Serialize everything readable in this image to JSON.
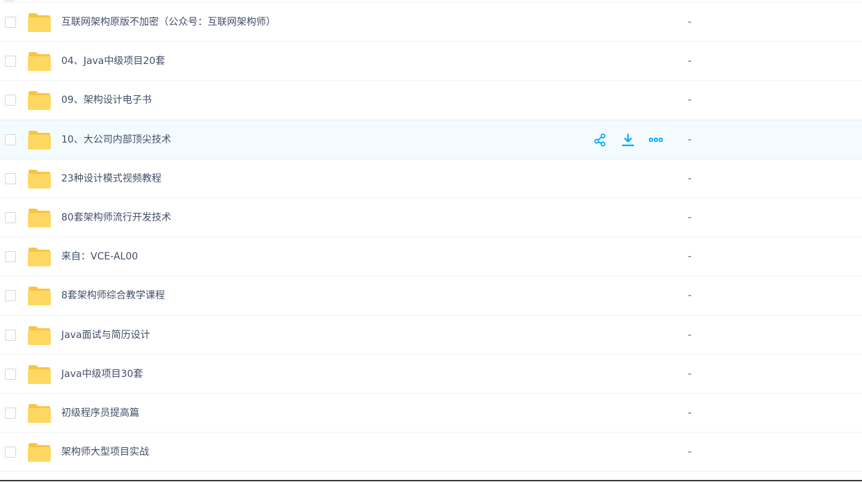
{
  "file_list": {
    "rows": [
      {
        "name": "互联网架构原版不加密（公众号：互联网架构师）",
        "size": "-"
      },
      {
        "name": "04、Java中级项目20套",
        "size": "-"
      },
      {
        "name": "09、架构设计电子书",
        "size": "-"
      },
      {
        "name": "10、大公司内部顶尖技术",
        "size": "-"
      },
      {
        "name": "23种设计模式视频教程",
        "size": "-"
      },
      {
        "name": "80套架构师流行开发技术",
        "size": "-"
      },
      {
        "name": "来自：VCE-AL00",
        "size": "-"
      },
      {
        "name": "8套架构师综合教学课程",
        "size": "-"
      },
      {
        "name": "Java面试与简历设计",
        "size": "-"
      },
      {
        "name": "Java中级项目30套",
        "size": "-"
      },
      {
        "name": "初级程序员提高篇",
        "size": "-"
      },
      {
        "name": "架构师大型项目实战",
        "size": "-"
      }
    ],
    "hovered_row_index": 3,
    "row_actions": [
      "share-icon",
      "download-icon",
      "more-icon"
    ]
  },
  "colors": {
    "text": "#424e67",
    "hover_bg": "#f4fbff",
    "accent": "#06a7ff",
    "folder_front": "#ffd863",
    "folder_back": "#f7c541"
  }
}
